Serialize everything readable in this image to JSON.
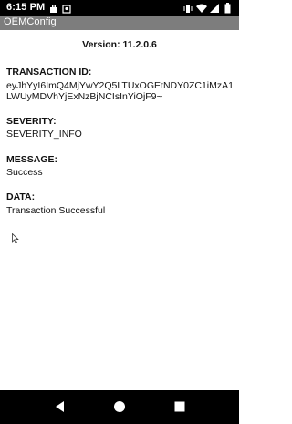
{
  "status_bar": {
    "time": "6:15 PM",
    "left_icons": [
      "suitcase-icon",
      "location-icon"
    ],
    "right_icons": [
      "vibrate-icon",
      "wifi-icon",
      "signal-icon",
      "battery-icon"
    ]
  },
  "app_bar": {
    "title": "OEMConfig"
  },
  "content": {
    "version": "Version: 11.2.0.6",
    "transaction_id_label": "TRANSACTION ID:",
    "transaction_id_value": "eyJhYyI6ImQ4MjYwY2Q5LTUxOGEtNDY0ZC1iMzA1LWUyMDVhYjExNzBjNCIsInYiOjF9~",
    "severity_label": "SEVERITY:",
    "severity_value": "SEVERITY_INFO",
    "message_label": "MESSAGE:",
    "message_value": "Success",
    "data_label": "DATA:",
    "data_value": "Transaction Successful"
  },
  "nav_bar": {
    "buttons": [
      "back-icon",
      "home-icon",
      "recents-icon"
    ]
  }
}
